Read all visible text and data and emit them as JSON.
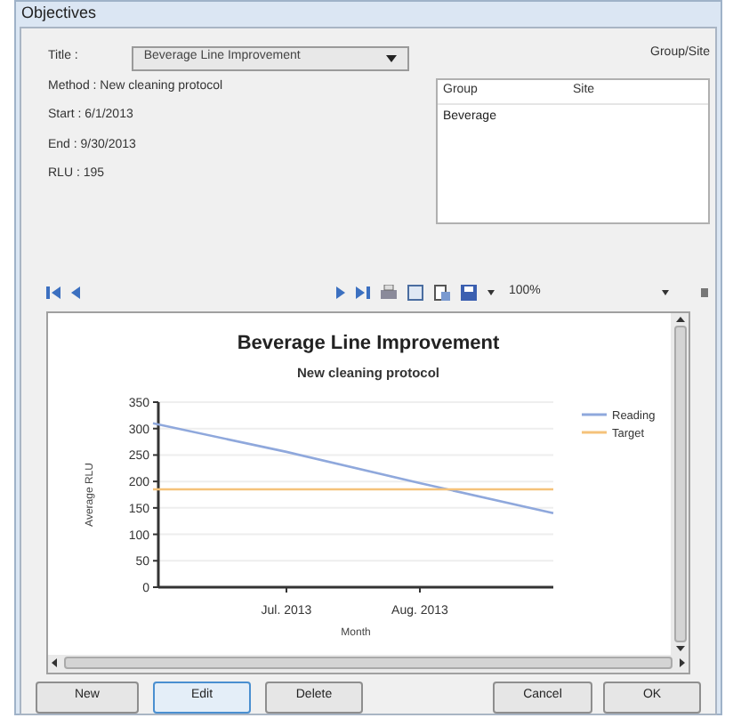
{
  "window": {
    "title": "Objectives"
  },
  "form": {
    "title_label": "Title :",
    "title_value": "Beverage Line Improvement",
    "group_site_label": "Group/Site",
    "details": [
      "Method : New cleaning protocol",
      "Start : 6/1/2013",
      "End : 9/30/2013",
      "RLU : 195"
    ]
  },
  "group_table": {
    "columns": [
      "Group",
      "Site"
    ],
    "rows": [
      [
        "Beverage"
      ]
    ]
  },
  "toolbar": {
    "zoom": "100%"
  },
  "report": {
    "chart_data": {
      "type": "line",
      "title": "Beverage Line Improvement",
      "subtitle": "New cleaning protocol",
      "xlabel": "Month",
      "ylabel": "Average RLU",
      "categories": [
        null,
        "Jul. 2013",
        "Aug. 2013",
        null
      ],
      "ylim": [
        0,
        350
      ],
      "grid": true,
      "legend": "right",
      "yticks": [
        0,
        50,
        100,
        150,
        200,
        250,
        300,
        350
      ],
      "series": [
        {
          "name": "Reading",
          "color": "#8fa8dc",
          "values": [
            310,
            256,
            197,
            140
          ]
        },
        {
          "name": "Target",
          "color": "#f5c27a",
          "values": [
            185,
            185,
            185,
            185
          ]
        }
      ]
    }
  },
  "buttons": [
    {
      "label": "New",
      "selected": false
    },
    {
      "label": "Edit",
      "selected": true
    },
    {
      "label": "Delete",
      "selected": false
    },
    {
      "label": "Cancel",
      "selected": false
    },
    {
      "label": "OK",
      "selected": false
    }
  ]
}
